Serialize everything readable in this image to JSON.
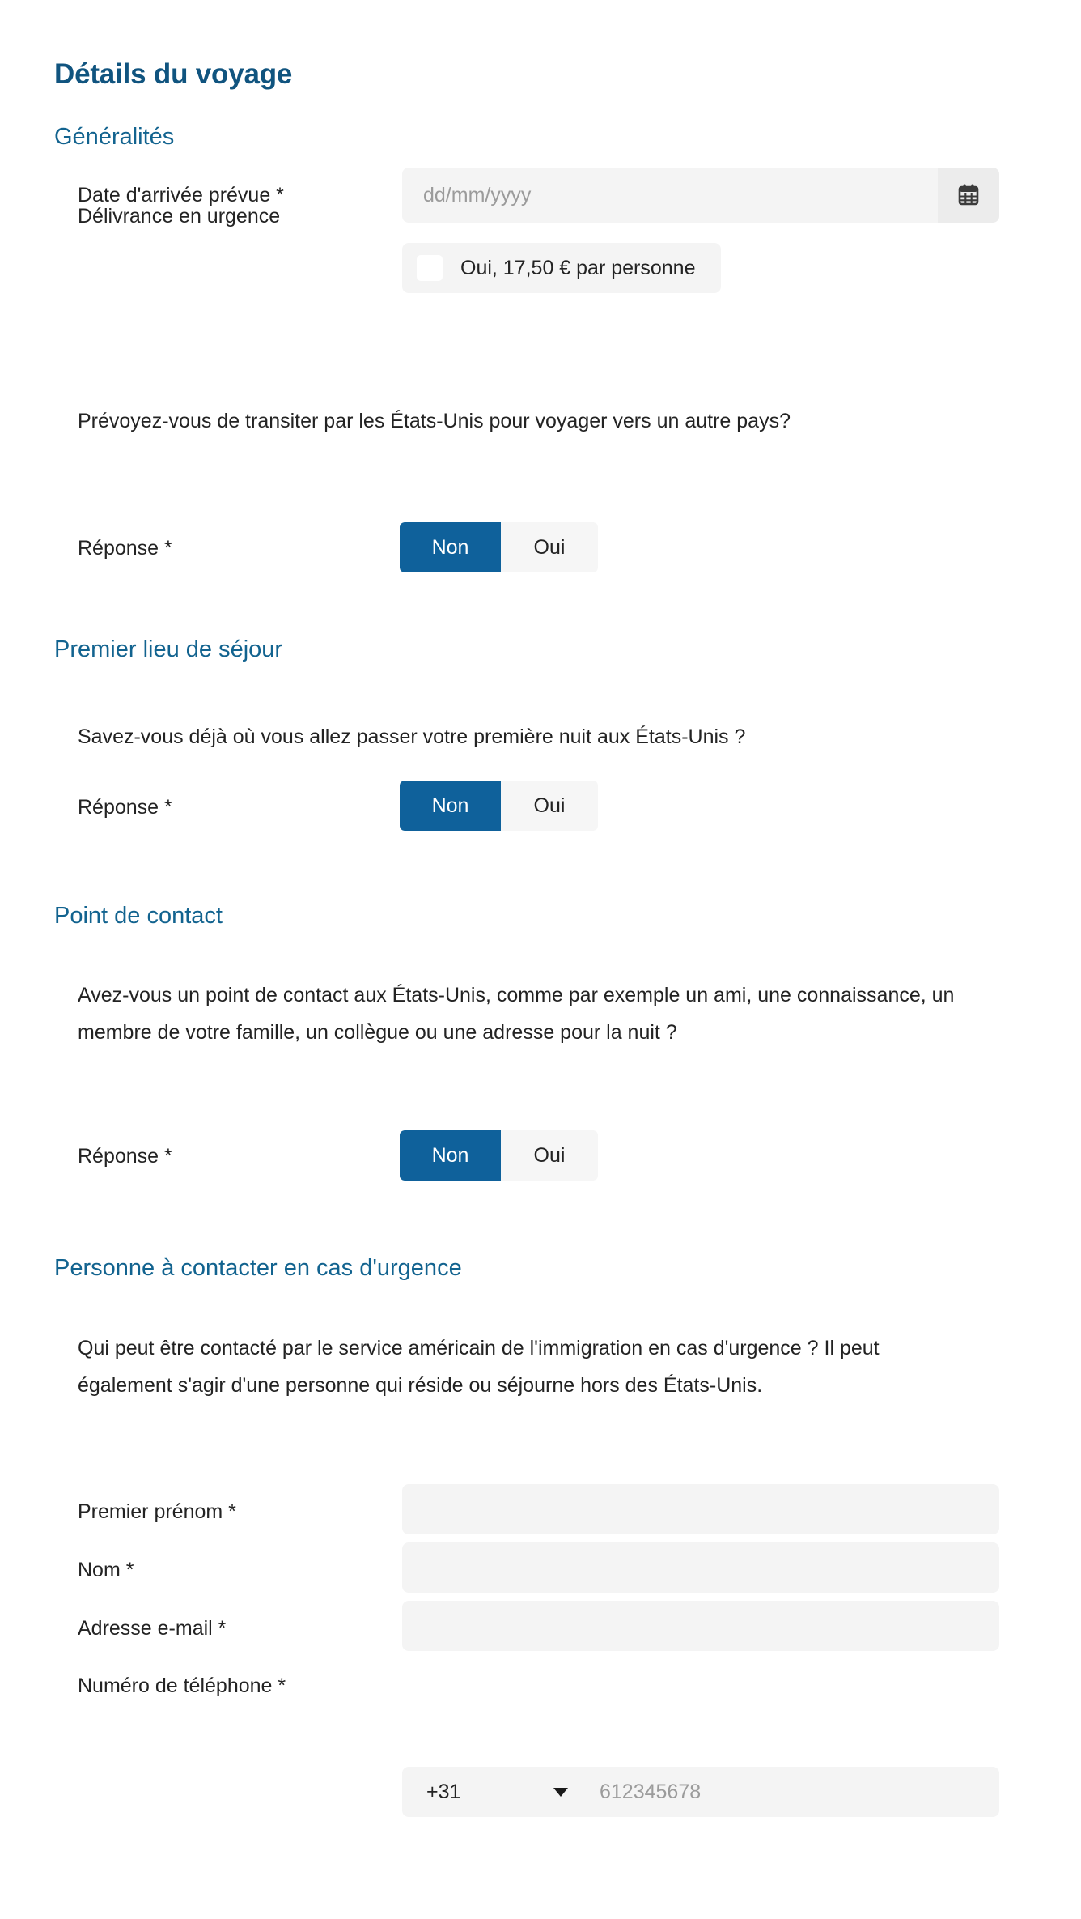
{
  "page": {
    "title": "Détails du voyage",
    "accent_blue": "#0f619b",
    "heading_blue": "#12638f",
    "title_blue": "#10547f",
    "field_bg": "#f4f4f4",
    "text_color": "#232323",
    "placeholder_color": "#9b9b9b"
  },
  "sections": {
    "generalites": {
      "heading": "Généralités",
      "date_label": "Date d'arrivée prévue *",
      "date_placeholder": "dd/mm/yyyy",
      "date_value": "",
      "calendar_icon": "calendar-icon",
      "urgence_label": "Délivrance en urgence",
      "urgence_option": "Oui, 17,50 € par personne",
      "urgence_checked": false,
      "transit_question": "Prévoyez-vous de transiter par les États-Unis pour voyager vers un autre pays?",
      "answer_label": "Réponse *",
      "toggle": {
        "no": "Non",
        "yes": "Oui",
        "selected": "Non"
      }
    },
    "premier_lieu": {
      "heading": "Premier lieu de séjour",
      "question": "Savez-vous déjà où vous allez passer votre première nuit aux États-Unis ?",
      "answer_label": "Réponse *",
      "toggle": {
        "no": "Non",
        "yes": "Oui",
        "selected": "Non"
      }
    },
    "point_contact": {
      "heading": "Point de contact",
      "question": "Avez-vous un point de contact aux États-Unis, comme par exemple un ami, une connaissance, un membre de votre famille, un collègue ou une adresse pour la nuit ?",
      "answer_label": "Réponse *",
      "toggle": {
        "no": "Non",
        "yes": "Oui",
        "selected": "Non"
      }
    },
    "personne_urgence": {
      "heading": "Personne à contacter en cas d'urgence",
      "question": "Qui peut être contacté par le service américain de l'immigration en cas d'urgence ? Il peut également s'agir d'une personne qui réside ou séjourne hors des États-Unis.",
      "fields": {
        "first_name_label": "Premier prénom *",
        "first_name_value": "",
        "last_name_label": "Nom *",
        "last_name_value": "",
        "email_label": "Adresse e-mail *",
        "email_value": "",
        "phone_label": "Numéro de téléphone *",
        "phone_country_code": "+31",
        "phone_placeholder": "612345678",
        "phone_value": ""
      }
    }
  }
}
